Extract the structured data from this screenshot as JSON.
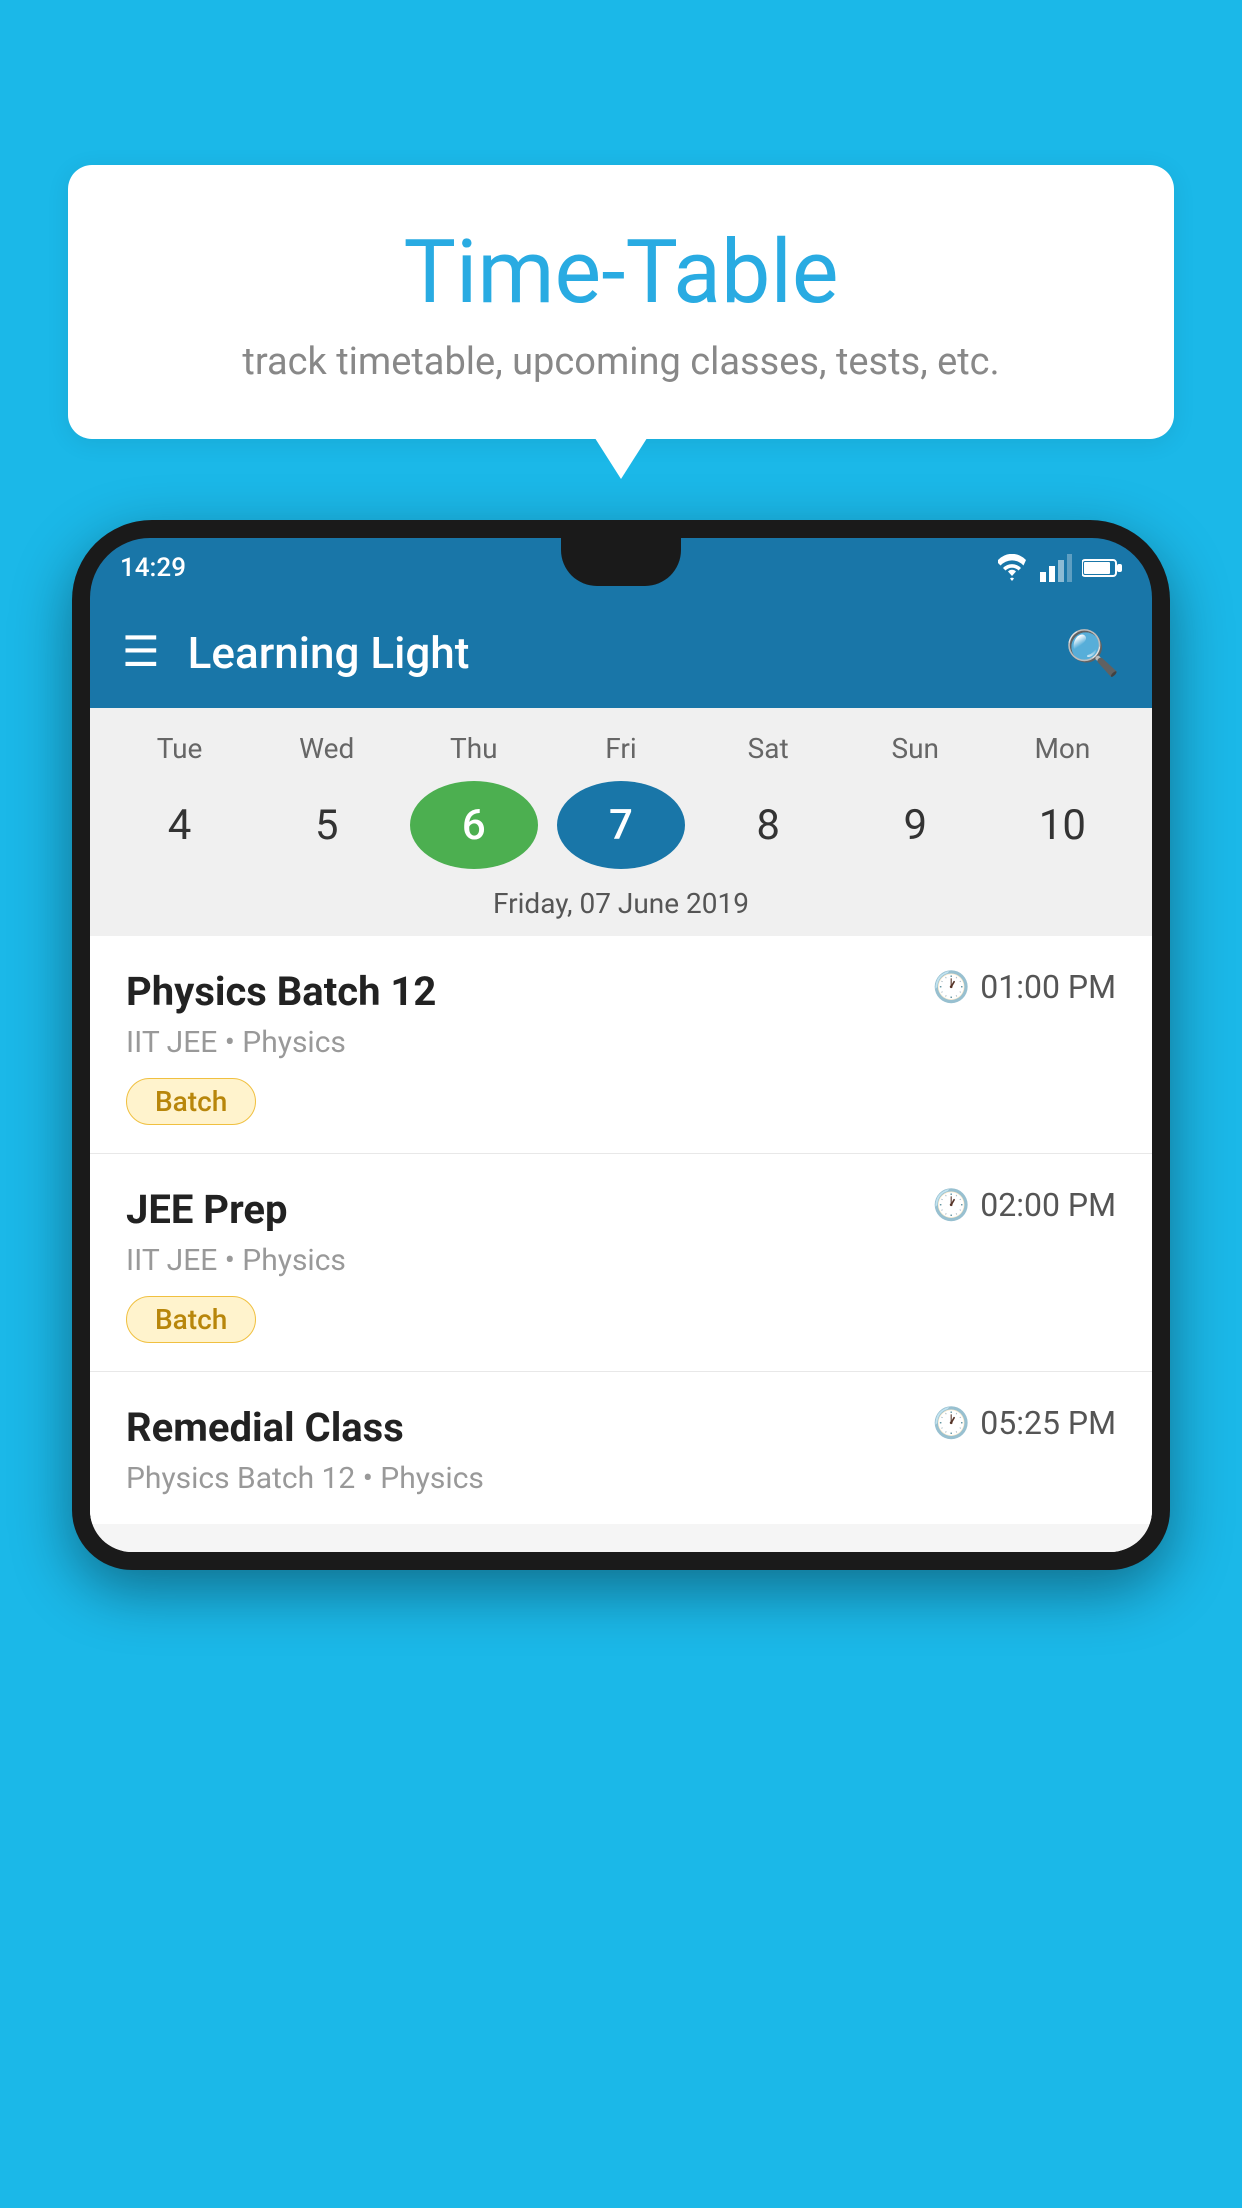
{
  "background_color": "#1BB8E8",
  "tooltip": {
    "title": "Time-Table",
    "subtitle": "track timetable, upcoming classes, tests, etc."
  },
  "phone": {
    "status_bar": {
      "time": "14:29"
    },
    "app_bar": {
      "title": "Learning Light"
    },
    "calendar": {
      "days": [
        "Tue",
        "Wed",
        "Thu",
        "Fri",
        "Sat",
        "Sun",
        "Mon"
      ],
      "dates": [
        "4",
        "5",
        "6",
        "7",
        "8",
        "9",
        "10"
      ],
      "today_index": 2,
      "selected_index": 3,
      "selected_date_label": "Friday, 07 June 2019"
    },
    "classes": [
      {
        "name": "Physics Batch 12",
        "time": "01:00 PM",
        "meta": "IIT JEE • Physics",
        "badge": "Batch"
      },
      {
        "name": "JEE Prep",
        "time": "02:00 PM",
        "meta": "IIT JEE • Physics",
        "badge": "Batch"
      },
      {
        "name": "Remedial Class",
        "time": "05:25 PM",
        "meta": "Physics Batch 12 • Physics",
        "badge": ""
      }
    ]
  }
}
